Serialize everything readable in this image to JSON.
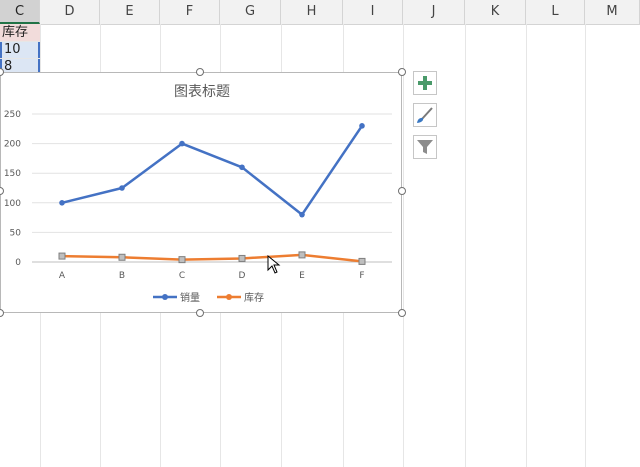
{
  "columns": [
    "C",
    "D",
    "E",
    "F",
    "G",
    "H",
    "I",
    "J",
    "K",
    "L",
    "M"
  ],
  "cells": {
    "c1": "库存",
    "c2": "10",
    "c3": "8"
  },
  "side_buttons": [
    {
      "name": "chart-elements-button",
      "icon": "plus-icon"
    },
    {
      "name": "chart-styles-button",
      "icon": "brush-icon"
    },
    {
      "name": "chart-filters-button",
      "icon": "filter-icon"
    }
  ],
  "colors": {
    "sales": "#4472c4",
    "stock": "#ed7d31",
    "accent": "#217346"
  },
  "chart_data": {
    "type": "line",
    "title": "图表标题",
    "categories": [
      "A",
      "B",
      "C",
      "D",
      "E",
      "F"
    ],
    "series": [
      {
        "name": "销量",
        "values": [
          100,
          125,
          200,
          160,
          80,
          230
        ]
      },
      {
        "name": "库存",
        "values": [
          10,
          8,
          4,
          6,
          12,
          1
        ]
      }
    ],
    "ylim": [
      0,
      250
    ],
    "yticks": [
      "250",
      "200",
      "150",
      "100",
      "50",
      "0"
    ],
    "legend": "bottom",
    "grid": true
  }
}
